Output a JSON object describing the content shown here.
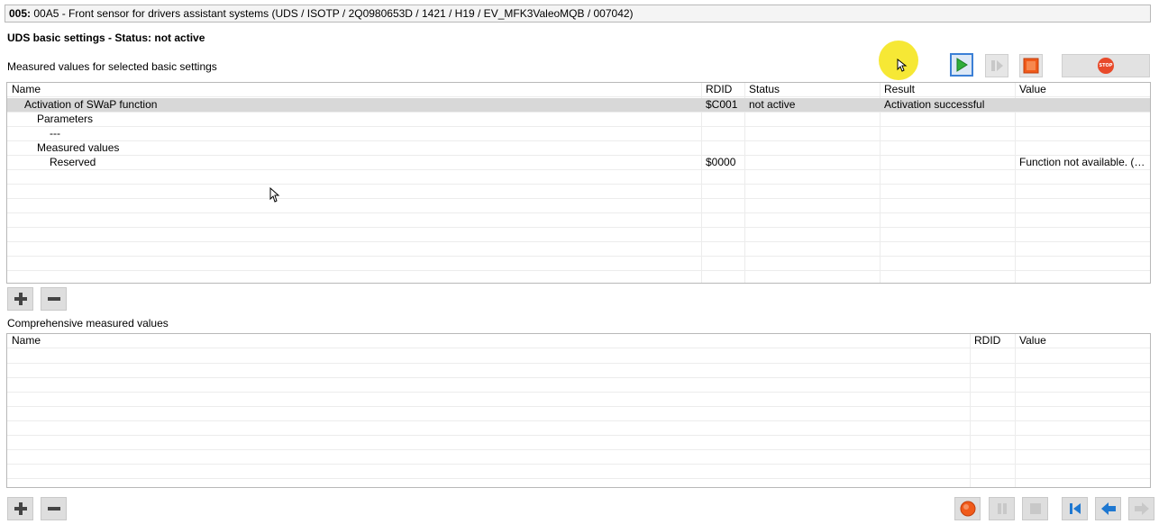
{
  "header": {
    "code": "005:",
    "text": " 00A5 - Front sensor for drivers assistant systems  (UDS / ISOTP / 2Q0980653D / 1421 / H19 / EV_MFK3ValeoMQB / 007042)"
  },
  "basic_settings": {
    "title": "UDS basic settings - Status: not active",
    "measured_label": "Measured values for selected basic settings",
    "columns": [
      "Name",
      "RDID",
      "Status",
      "Result",
      "Value"
    ],
    "rows": [
      {
        "name": "Activation of SWaP function",
        "rdid": "$C001",
        "status": "not active",
        "result": "Activation successful",
        "value": ""
      },
      {
        "name": "Parameters",
        "rdid": "",
        "status": "",
        "result": "",
        "value": ""
      },
      {
        "name": "---",
        "rdid": "",
        "status": "",
        "result": "",
        "value": ""
      },
      {
        "name": "Measured values",
        "rdid": "",
        "status": "",
        "result": "",
        "value": ""
      },
      {
        "name": "Reserved",
        "rdid": "$0000",
        "status": "",
        "result": "",
        "value": "Function not available. (Sl..."
      }
    ]
  },
  "comprehensive": {
    "label": "Comprehensive measured values",
    "columns": [
      "Name",
      "RDID",
      "Value"
    ]
  },
  "toolbar": {
    "stop_label": "STOP"
  },
  "colors": {
    "play_green": "#2fae3a",
    "stop_orange": "#f05a1a",
    "nav_blue": "#1f78d1",
    "cursor_highlight": "#f5e72a"
  }
}
